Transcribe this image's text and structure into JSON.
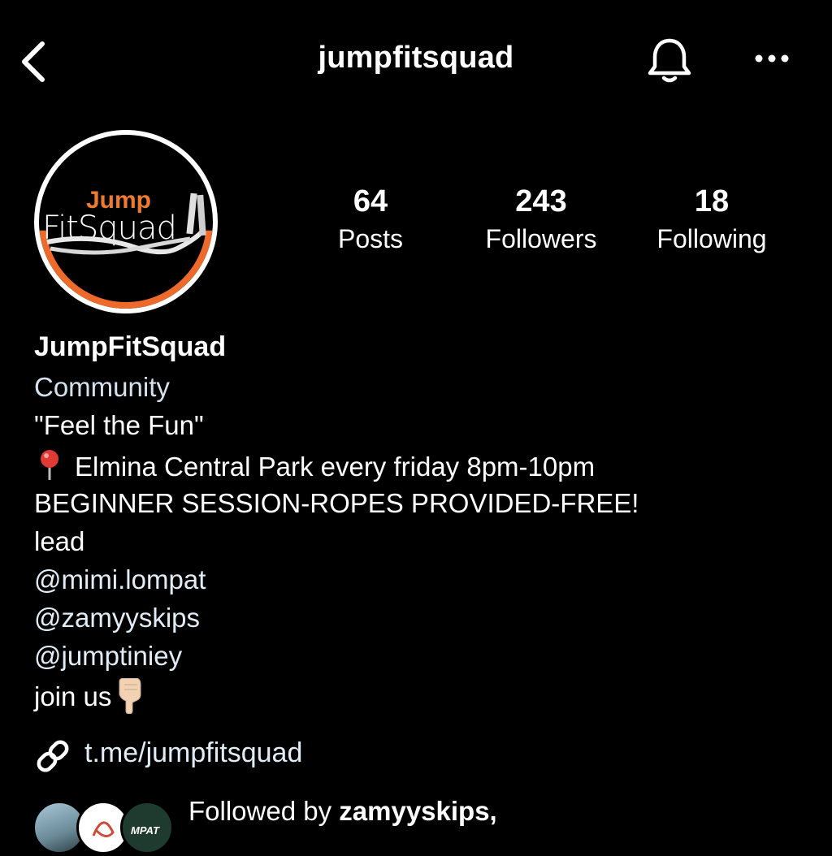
{
  "header": {
    "title": "jumpfitsquad",
    "back_icon": "chevron-left-icon",
    "bell_icon": "bell-icon",
    "more_icon": "more-horizontal-icon"
  },
  "avatar": {
    "logo_word_top": "Jump",
    "logo_word_bottom": "FitSquad",
    "accent_color": "#ee6a2a"
  },
  "stats": [
    {
      "value": "64",
      "label": "Posts"
    },
    {
      "value": "243",
      "label": "Followers"
    },
    {
      "value": "18",
      "label": "Following"
    }
  ],
  "bio": {
    "name": "JumpFitSquad",
    "category": "Community",
    "tagline": "\"Feel the Fun\"",
    "location_line": "Elmina Central Park every friday 8pm-10pm",
    "session_line": "BEGINNER SESSION-ROPES PROVIDED-FREE!",
    "lead_label": "lead",
    "mentions": [
      "@mimi.lompat",
      "@zamyyskips",
      "@jumptiniey"
    ],
    "join_line": "join us"
  },
  "link": {
    "icon": "link-icon",
    "text": "t.me/jumpfitsquad"
  },
  "followed_by": {
    "prefix": "Followed by ",
    "name": "zamyyskips,",
    "mini_avatar_text": "MPAT"
  }
}
